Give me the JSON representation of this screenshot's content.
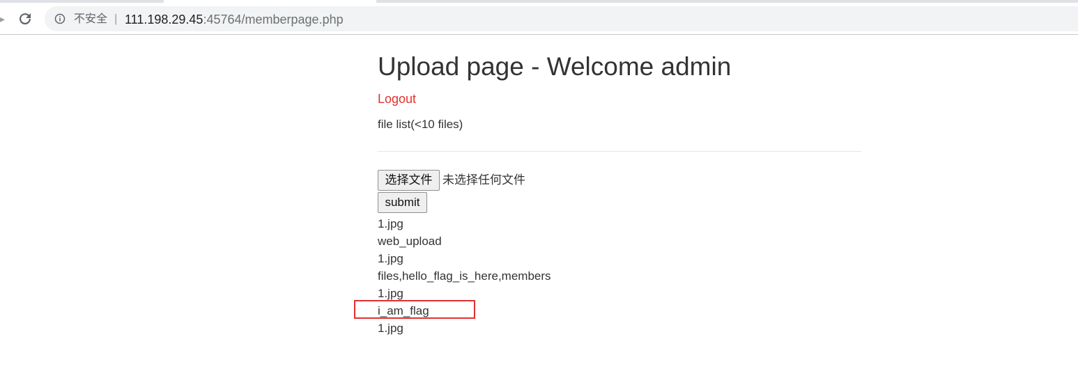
{
  "browser": {
    "security_label": "不安全",
    "separator": "|",
    "url_host": "111.198.29.45",
    "url_rest": ":45764/memberpage.php",
    "icons": {
      "back": "arrow-left-icon",
      "reload": "reload-icon",
      "info": "info-circle-icon"
    }
  },
  "page": {
    "title": "Upload page - Welcome admin",
    "logout_label": "Logout",
    "file_list_label": "file list(<10 files)",
    "choose_file_label": "选择文件",
    "no_file_text": "未选择任何文件",
    "submit_label": "submit",
    "files": [
      "1.jpg",
      "web_upload",
      "1.jpg",
      "files,hello_flag_is_here,members",
      "1.jpg",
      "i_am_flag",
      "1.jpg"
    ],
    "colors": {
      "logout": "#e4312b",
      "highlight": "#e03030"
    }
  }
}
